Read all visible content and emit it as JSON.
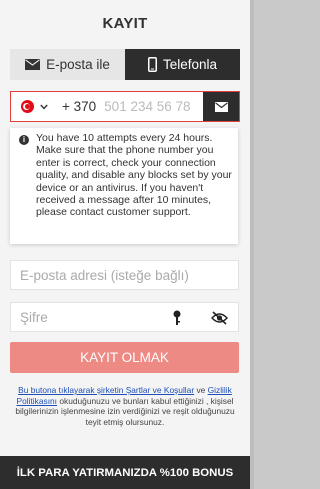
{
  "title": "KAYIT",
  "tabs": {
    "email_label": "E-posta ile",
    "phone_label": "Telefonla",
    "active": "phone"
  },
  "phone": {
    "country_code": "+ 370",
    "placeholder": "501 234 56 78",
    "flag": "turkey-flag-icon"
  },
  "tooltip": {
    "text": "You have 10 attempts every 24 hours. Make sure that the phone number you enter is correct, check your connection quality, and disable any blocks set by your device or an antivirus. If you haven't received a message after 10 minutes, please contact customer support."
  },
  "email_field": {
    "placeholder": "E-posta adresi (isteğe bağlı)"
  },
  "password_field": {
    "placeholder": "Şifre"
  },
  "submit_label": "KAYIT OLMAK",
  "terms": {
    "link1": "Bu butona tıklayarak şirketin Şartlar ve Koşullar",
    "text1": " ve ",
    "link2": "Gizlilik Politikasını",
    "text2": " okuduğunuzu ve bunları kabul ettiğinizi , kişisel bilgilerinizin işlenmesine izin verdiğinizi ve reşit olduğunuzu teyit etmiş olursunuz."
  },
  "footer": "İLK PARA YATIRMANIZDA %100 BONUS",
  "colors": {
    "accent_red": "#e0413a",
    "submit_bg": "#ee8a84",
    "dark": "#2d2d2d",
    "link": "#1e4fb6"
  }
}
